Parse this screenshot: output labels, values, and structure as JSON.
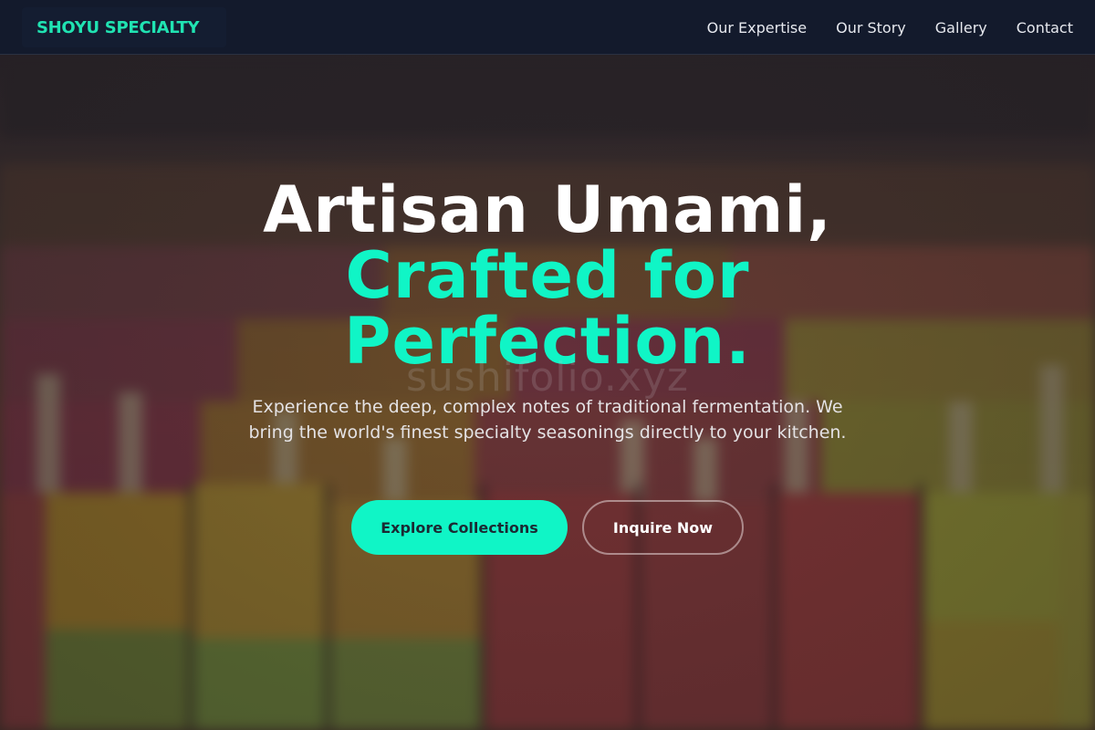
{
  "brand": {
    "name": "SHOYU SPECIALTY",
    "accent_color": "#10f5c6"
  },
  "nav": {
    "links": [
      "Our Expertise",
      "Our Story",
      "Gallery",
      "Contact"
    ]
  },
  "hero": {
    "headline_line1": "Artisan Umami,",
    "headline_line2": "Crafted for",
    "headline_line3": "Perfection.",
    "watermark": "sushifolio.xyz",
    "description": "Experience the deep, complex notes of traditional fermentation. We bring the world's finest specialty seasonings directly to your kitchen.",
    "primary_cta": "Explore Collections",
    "secondary_cta": "Inquire Now",
    "background_image": "blurred rows of colorful popsicles"
  }
}
